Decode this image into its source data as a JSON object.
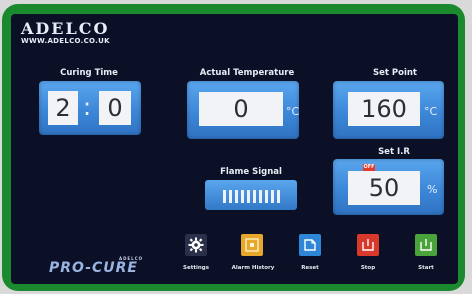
{
  "logo": {
    "name": "ADELCO",
    "url": "WWW.ADELCO.CO.UK"
  },
  "curing_time": {
    "label": "Curing Time",
    "minutes": "2",
    "seconds": "0",
    "separator": ":"
  },
  "actual_temperature": {
    "label": "Actual Temperature",
    "value": "0",
    "unit": "°C"
  },
  "set_point": {
    "label": "Set Point",
    "value": "160",
    "unit": "°C"
  },
  "flame_signal": {
    "label": "Flame Signal",
    "level_fraction": 0
  },
  "set_ir": {
    "label": "Set I.R",
    "badge": "OFF",
    "value": "50",
    "unit": "%"
  },
  "brand": {
    "name": "PRO-CURE",
    "sub": "ADELCO"
  },
  "buttons": [
    {
      "label": "Settings",
      "icon": "gear-icon",
      "color": "#2a2f4a"
    },
    {
      "label": "Alarm History",
      "icon": "alarm-history-icon",
      "color": "#e6a72a"
    },
    {
      "label": "Reset",
      "icon": "reset-icon",
      "color": "#2f86d6"
    },
    {
      "label": "Stop",
      "icon": "stop-icon",
      "color": "#d8392a"
    },
    {
      "label": "Start",
      "icon": "start-icon",
      "color": "#4aa33a"
    }
  ]
}
